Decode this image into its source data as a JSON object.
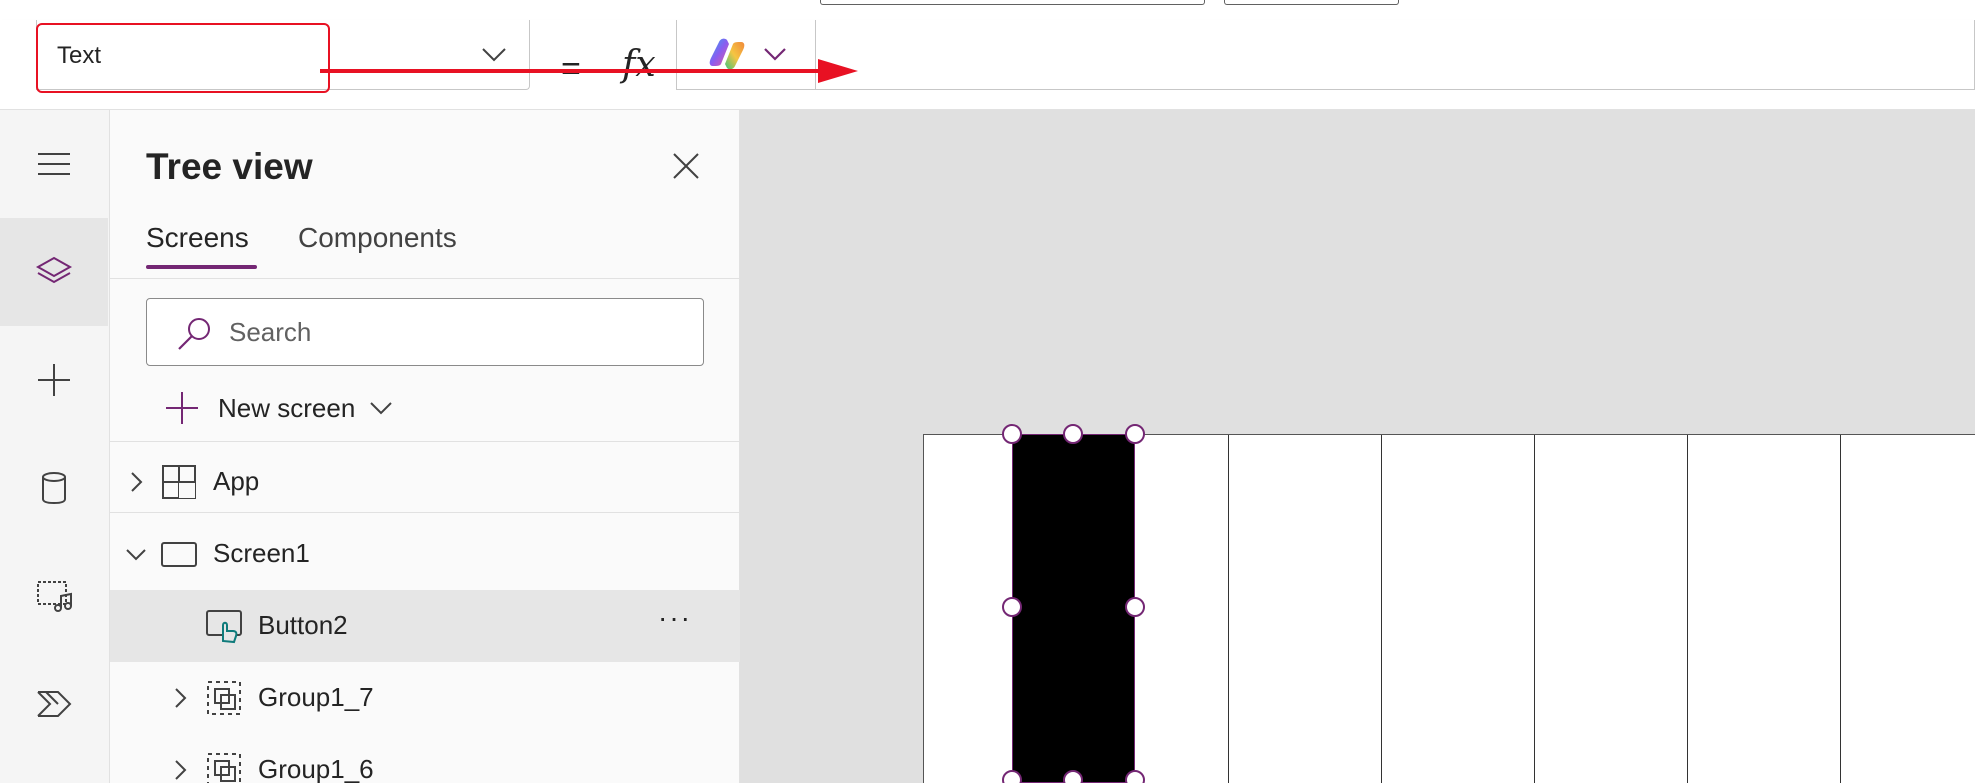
{
  "formula_bar": {
    "property_value": "Text",
    "equals_label": "=",
    "fx_label": "fx",
    "formula_value": ""
  },
  "left_rail": {
    "items": [
      {
        "name": "hamburger-menu-icon",
        "active": false
      },
      {
        "name": "tree-view-layers-icon",
        "active": true
      },
      {
        "name": "insert-plus-icon",
        "active": false
      },
      {
        "name": "data-cylinder-icon",
        "active": false
      },
      {
        "name": "media-icon",
        "active": false
      },
      {
        "name": "power-automate-icon",
        "active": false
      }
    ]
  },
  "tree_view": {
    "title": "Tree view",
    "tabs": [
      {
        "label": "Screens",
        "active": true
      },
      {
        "label": "Components",
        "active": false
      }
    ],
    "search_placeholder": "Search",
    "new_screen_label": "New screen",
    "items": [
      {
        "label": "App",
        "type": "app",
        "expanded": false,
        "selected": false
      },
      {
        "label": "Screen1",
        "type": "screen",
        "expanded": true,
        "selected": false
      },
      {
        "label": "Button2",
        "type": "button",
        "selected": true,
        "more": "···"
      },
      {
        "label": "Group1_7",
        "type": "group",
        "expanded": false,
        "selected": false
      },
      {
        "label": "Group1_6",
        "type": "group",
        "expanded": false,
        "selected": false
      }
    ]
  },
  "colors": {
    "accent": "#742774",
    "highlight_red": "#e81123",
    "canvas_bg": "#e0e0e0",
    "selected_row": "#e6e6e6"
  }
}
